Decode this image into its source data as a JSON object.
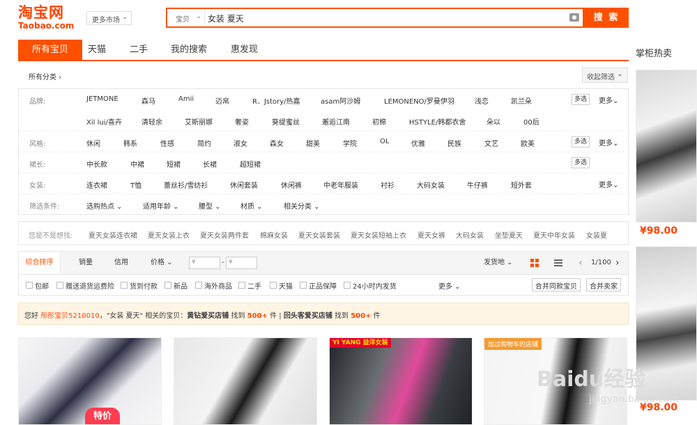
{
  "logo": {
    "cn": "淘宝网",
    "en": "Taobao.com"
  },
  "market_dropdown": "更多市场",
  "search": {
    "type": "宝贝",
    "query": "女装 夏天",
    "button": "搜 索"
  },
  "tabs": [
    "所有宝贝",
    "天猫",
    "二手",
    "我的搜索",
    "惠发现"
  ],
  "sidebar": {
    "title": "掌柜热卖",
    "prices": [
      "¥98.00",
      "¥98.00"
    ]
  },
  "breadcrumb": "所有分类 ›",
  "collapse_label": "收起筛选 ⌃",
  "filters": {
    "brand": {
      "label": "品牌:",
      "row1": [
        "JETMONE",
        "森马",
        "Amii",
        "迈帛",
        "R．Jstory/热嘉",
        "asam阿沙姆",
        "LEMONENO/罗曼伊羽",
        "浅恋",
        "凯兰朵"
      ],
      "row2": [
        "Xil lui/喜卉",
        "清轻余",
        "艾斯丽娜",
        "奢姿",
        "葵缇蜜丝",
        "邂逅江南",
        "初棉",
        "HSTYLE/韩都衣舍",
        "朵以",
        "00后"
      ]
    },
    "style": {
      "label": "风格:",
      "items": [
        "休闲",
        "韩系",
        "性感",
        "简约",
        "淑女",
        "森女",
        "甜美",
        "学院",
        "OL",
        "优雅",
        "民族",
        "文艺",
        "欧美"
      ]
    },
    "skirt_length": {
      "label": "裙长:",
      "items": [
        "中长款",
        "中裙",
        "短裙",
        "长裙",
        "超短裙"
      ]
    },
    "women": {
      "label": "女装:",
      "items": [
        "连衣裙",
        "T恤",
        "蕾丝衫/雪纺衫",
        "休闲套装",
        "休闲裤",
        "中老年服装",
        "衬衫",
        "大码女装",
        "牛仔裤",
        "短外套"
      ]
    },
    "conditions": {
      "label": "筛选条件:",
      "items": [
        "选购热点 ⌄",
        "适用年龄 ⌄",
        "腰型 ⌄",
        "材质 ⌄",
        "相关分类 ⌄"
      ]
    },
    "multi_label": "多选",
    "more_label": "更多⌄"
  },
  "suggest": {
    "label": "您是不是想找:",
    "items": [
      "夏天女装连衣裙",
      "夏天女装上衣",
      "夏天女装两件套",
      "棉麻女装",
      "夏天女装套装",
      "夏天女装短袖上衣",
      "夏天女裤",
      "大码女装",
      "坐垫夏天",
      "夏天中年女装",
      "女装夏"
    ]
  },
  "sortbar": {
    "items": [
      "综合排序",
      "销量",
      "信用",
      "价格 ⌄"
    ],
    "price_from": "¥",
    "price_to": "¥",
    "dash": "-",
    "ship_from": "发货地 ⌄",
    "page": "1/100",
    "prev": "‹",
    "next": "›"
  },
  "options": {
    "items": [
      "包邮",
      "赠送退货运费险",
      "货到付款",
      "新品",
      "海外商品",
      "二手",
      "天猫",
      "正品保障",
      "24小时内发货"
    ],
    "more": "更多 ⌄",
    "merge_same": "合并同款宝贝",
    "merge_seller": "合并卖家"
  },
  "notice": {
    "greet": "您好 ",
    "user": "彤彤宝贝5210010",
    "text1": "，\"女装 夏天\" 相关的宝贝：",
    "shop1": "黄钻爱买店铺",
    "found1": " 找到 ",
    "count1": "500+",
    "unit1": " 件",
    "sep": "  |  ",
    "shop2": "回头客爱买店铺",
    "found2": " 找到 ",
    "count2": "500+",
    "unit2": " 件"
  },
  "products": [
    {
      "tag": "",
      "price_tag": "特价"
    },
    {
      "tag": ""
    },
    {
      "tag": "YI YANG 益洋女装"
    },
    {
      "tag": "加过购物车的店铺"
    }
  ],
  "watermark": {
    "main": "Baidu经验",
    "sub": "jingyan.baidu.com"
  },
  "colors": {
    "accent": "#ff5000",
    "price": "#ff4400"
  }
}
